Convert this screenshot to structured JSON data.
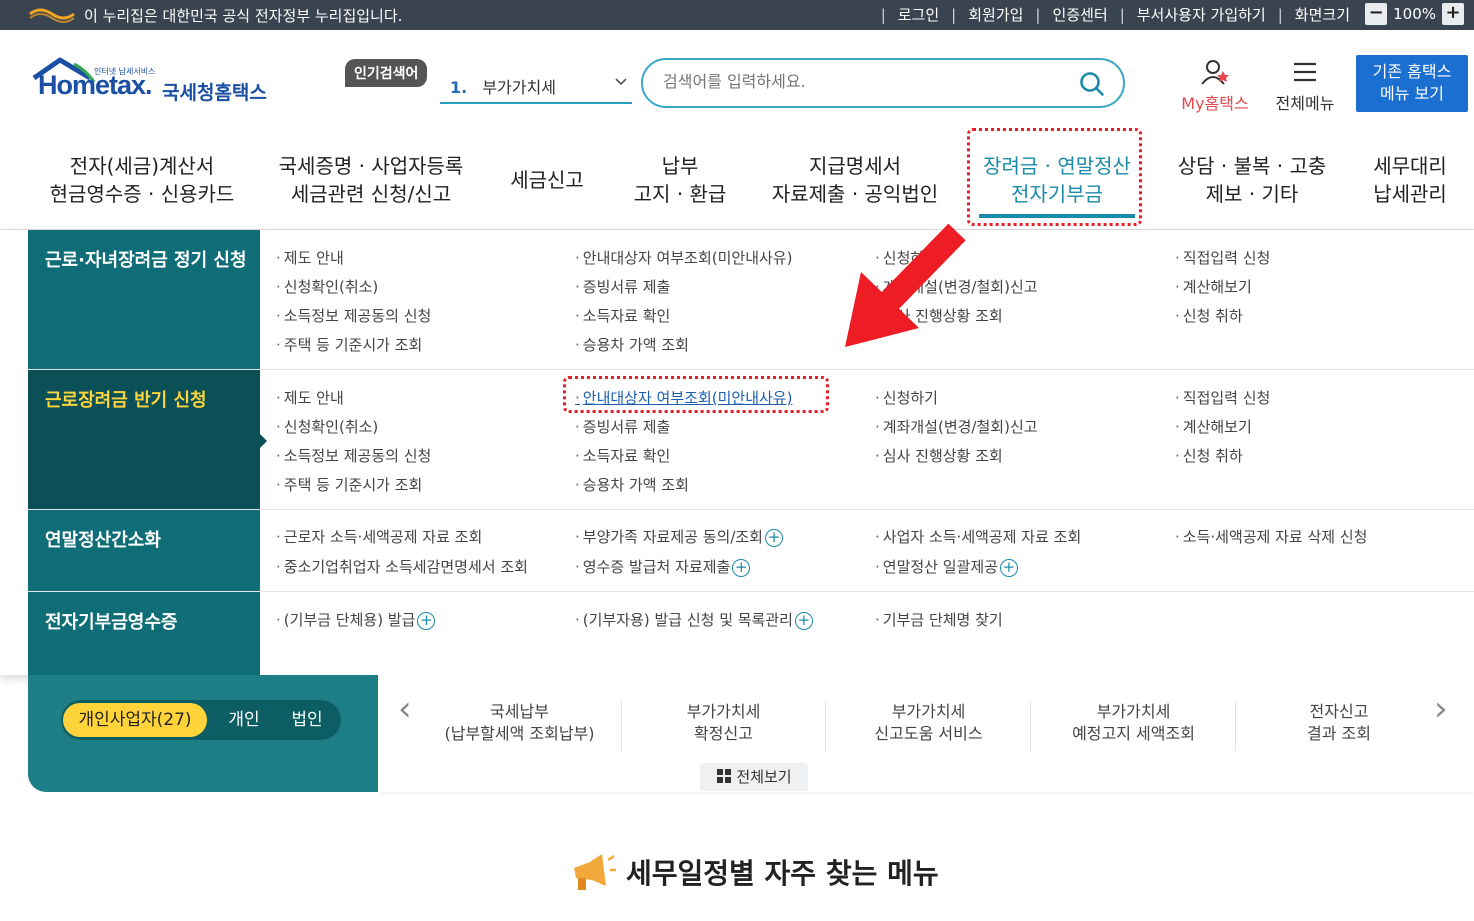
{
  "gov_bar": {
    "text": "이 누리집은 대한민국 공식 전자정부 누리집입니다.",
    "links": [
      "로그인",
      "회원가입",
      "인증센터",
      "부서사용자 가입하기",
      "화면크기"
    ],
    "zoom_minus": "−",
    "zoom_value": "100%",
    "zoom_plus": "+"
  },
  "header": {
    "logo_tiny": "인터넷 납세서비스",
    "logo_en": "Hometax.",
    "logo_ko": "국세청홈택스",
    "popular_badge": "인기검색어",
    "popular_rank": "1.",
    "popular_keyword": "부가가치세",
    "search_placeholder": "검색어를 입력하세요.",
    "my_hometax": "My홈택스",
    "all_menu": "전체메뉴",
    "old_menu_line1": "기존 홈택스",
    "old_menu_line2": "메뉴 보기"
  },
  "gnb": [
    "전자(세금)계산서\n현금영수증 · 신용카드",
    "국세증명 · 사업자등록\n세금관련 신청/신고",
    "세금신고",
    "납부\n고지 · 환급",
    "지급명세서\n자료제출 · 공익법인",
    "장려금 · 연말정산\n전자기부금",
    "상담 · 불복 · 고충\n제보 · 기타",
    "세무대리\n납세관리"
  ],
  "mega": {
    "rows": [
      {
        "title": "근로·자녀장려금 정기 신청",
        "links": [
          [
            "제도 안내",
            "신청확인(취소)",
            "소득정보 제공동의 신청",
            "주택 등 기준시가 조회"
          ],
          [
            "안내대상자 여부조회(미안내사유)",
            "증빙서류 제출",
            "소득자료 확인",
            "승용차 가액 조회"
          ],
          [
            "신청하기",
            "계좌개설(변경/철회)신고",
            "심사 진행상황 조회"
          ],
          [
            "직접입력 신청",
            "계산해보기",
            "신청 취하"
          ]
        ]
      },
      {
        "title": "근로장려금 반기 신청",
        "links": [
          [
            "제도 안내",
            "신청확인(취소)",
            "소득정보 제공동의 신청",
            "주택 등 기준시가 조회"
          ],
          [
            "안내대상자 여부조회(미안내사유)",
            "증빙서류 제출",
            "소득자료 확인",
            "승용차 가액 조회"
          ],
          [
            "신청하기",
            "계좌개설(변경/철회)신고",
            "심사 진행상황 조회"
          ],
          [
            "직접입력 신청",
            "계산해보기",
            "신청 취하"
          ]
        ]
      },
      {
        "title": "연말정산간소화",
        "links": [
          [
            "근로자 소득·세액공제 자료 조회",
            "중소기업취업자 소득세감면명세서 조회"
          ],
          [
            "부양가족 자료제공 동의/조회",
            "영수증 발급처 자료제출"
          ],
          [
            "사업자 소득·세액공제 자료 조회",
            "연말정산 일괄제공"
          ],
          [
            "소득·세액공제 자료 삭제 신청"
          ]
        ]
      },
      {
        "title": "전자기부금영수증",
        "links": [
          [
            "(기부금 단체용) 발급"
          ],
          [
            "(기부자용) 발급 신청 및 목록관리"
          ],
          [
            "기부금 단체명 찾기"
          ],
          []
        ]
      }
    ]
  },
  "quick": {
    "tabs": [
      "개인사업자(27)",
      "개인",
      "법인"
    ],
    "items": [
      "국세납부\n(납부할세액 조회납부)",
      "부가가치세\n확정신고",
      "부가가치세\n신고도움 서비스",
      "부가가치세\n예정고지 세액조회",
      "전자신고\n결과 조회"
    ],
    "view_all": "전체보기",
    "prev": "‹",
    "next": "›"
  },
  "section_title": "세무일정별 자주 찾는 메뉴",
  "colors": {
    "gov_bar": "#3a4451",
    "brand_blue": "#1a4fa3",
    "accent_teal": "#1b8ba8",
    "menu_title_bg": "#0f6d78",
    "menu_title_active_bg": "#0b4f57",
    "active_title_text": "#ffd43b",
    "annotation_red": "#e41e26"
  }
}
